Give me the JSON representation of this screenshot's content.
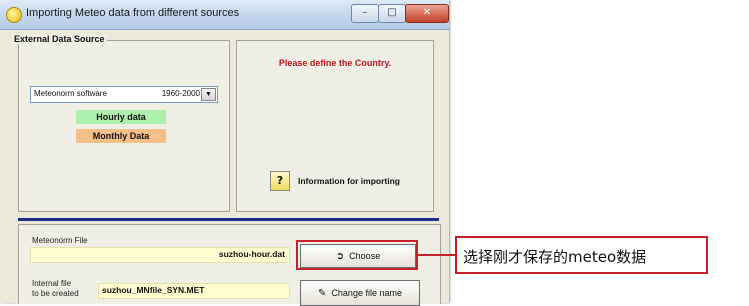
{
  "window": {
    "title": "Importing Meteo data from different sources",
    "controls": {
      "minimize": "–",
      "maximize": "□",
      "close": "✕"
    }
  },
  "external_source": {
    "group_label": "External Data Source",
    "source_select": {
      "value": "Meteonorm software",
      "range": "1960-2000"
    },
    "hourly_label": "Hourly data",
    "monthly_label": "Monthly Data"
  },
  "status": {
    "warning": "Please define the Country.",
    "help_icon": "?",
    "info_label": "Information for importing"
  },
  "meteonorm": {
    "label": "Meteonorm File",
    "file_value": "suzhou-hour.dat",
    "choose_label": "Choose"
  },
  "internal": {
    "label_line1": "Internal file",
    "label_line2": "to be created",
    "file_value": "suzhou_MNfile_SYN.MET",
    "change_label": "Change file name"
  },
  "annotation": {
    "text": "选择刚才保存的meteo数据",
    "color": "#c8202a"
  }
}
